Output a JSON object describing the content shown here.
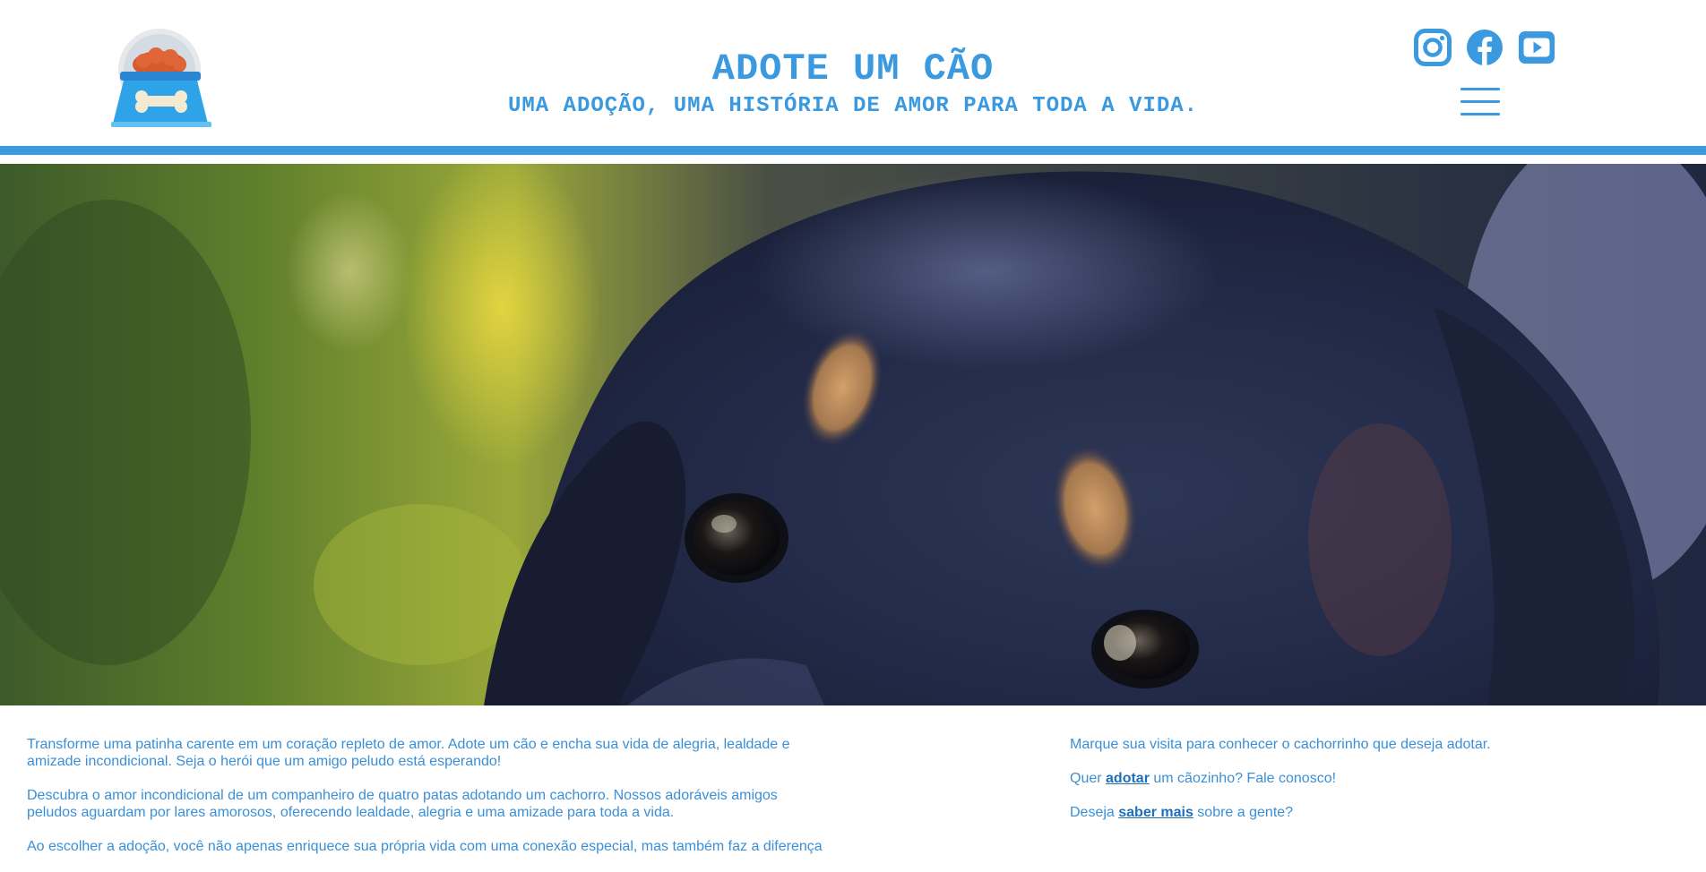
{
  "header": {
    "logo_icon": "dog-food-bowl-icon",
    "title": "ADOTE UM CÃO",
    "subtitle": "UMA ADOÇÃO, UMA HISTÓRIA DE AMOR PARA TODA A VIDA.",
    "social": [
      {
        "icon": "instagram-icon"
      },
      {
        "icon": "facebook-icon"
      },
      {
        "icon": "youtube-icon"
      }
    ],
    "menu_icon": "hamburger-menu-icon"
  },
  "hero": {
    "image": "close-up of a black and tan dog's face"
  },
  "content": {
    "left": [
      "Transforme uma patinha carente em um coração repleto de amor. Adote um cão e encha sua vida de alegria, lealdade e amizade incondicional. Seja o herói que um amigo peludo está esperando!",
      "Descubra o amor incondicional de um companheiro de quatro patas adotando um cachorro. Nossos adoráveis amigos peludos aguardam por lares amorosos, oferecendo lealdade, alegria e uma amizade para toda a vida.",
      "Ao escolher a adoção, você não apenas enriquece sua própria vida com uma conexão especial, mas também faz a diferença"
    ],
    "right": {
      "visit": "Marque sua visita para conhecer o cachorrinho que deseja adotar.",
      "adopt_prefix": "Quer ",
      "adopt_link": "adotar",
      "adopt_suffix": " um cãozinho? Fale conosco!",
      "more_prefix": "Deseja ",
      "more_link": "saber mais",
      "more_suffix": " sobre a gente?"
    }
  },
  "colors": {
    "accent": "#3a99df",
    "text": "#3a8fd6",
    "link": "#1f6fb8"
  }
}
